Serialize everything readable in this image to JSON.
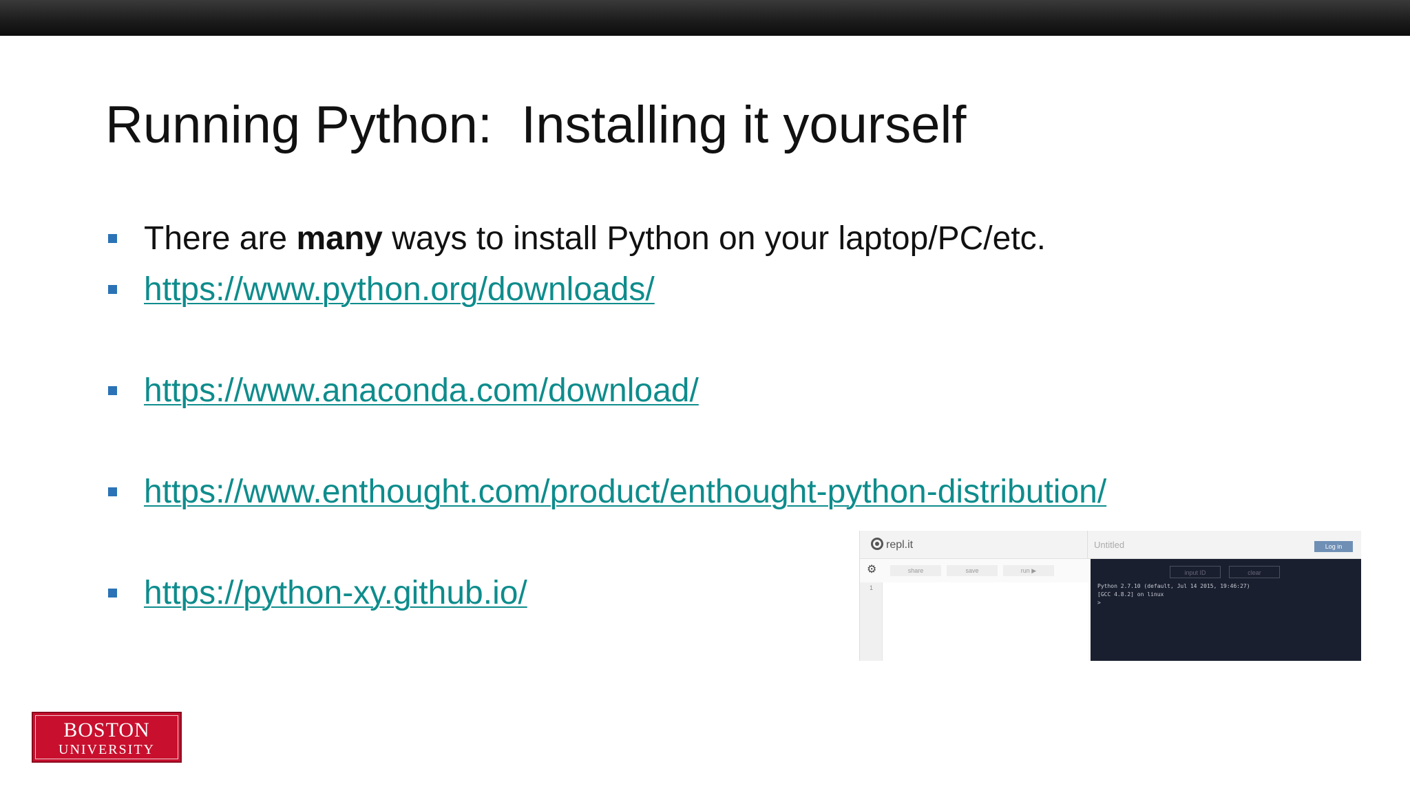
{
  "slide": {
    "title": "Running Python:  Installing it yourself",
    "bullets": [
      {
        "pre": "There are ",
        "bold": "many",
        "post": " ways to install Python on your laptop/PC/etc."
      },
      {
        "link": "https://www.python.org/downloads/"
      },
      {
        "link": "https://www.anaconda.com/download/"
      },
      {
        "link": "https://www.enthought.com/product/enthought-python-distribution/"
      },
      {
        "link": "https://python-xy.github.io/"
      }
    ]
  },
  "repl": {
    "logo": "repl.it",
    "doc_title": "Untitled",
    "login": "Log in",
    "toolbar": {
      "share": "share",
      "save": "save",
      "run": "run ▶"
    },
    "line_number": "1",
    "console_buttons": {
      "input": "input ID",
      "clear": "clear"
    },
    "console_lines": [
      "Python 2.7.10 (default, Jul 14 2015, 19:46:27)",
      "[GCC 4.8.2] on linux",
      "> "
    ]
  },
  "logo": {
    "line1": "BOSTON",
    "line2": "UNIVERSITY"
  },
  "colors": {
    "bullet": "#2b73b6",
    "link": "#0e8c8c",
    "bu_red": "#c8102e"
  }
}
